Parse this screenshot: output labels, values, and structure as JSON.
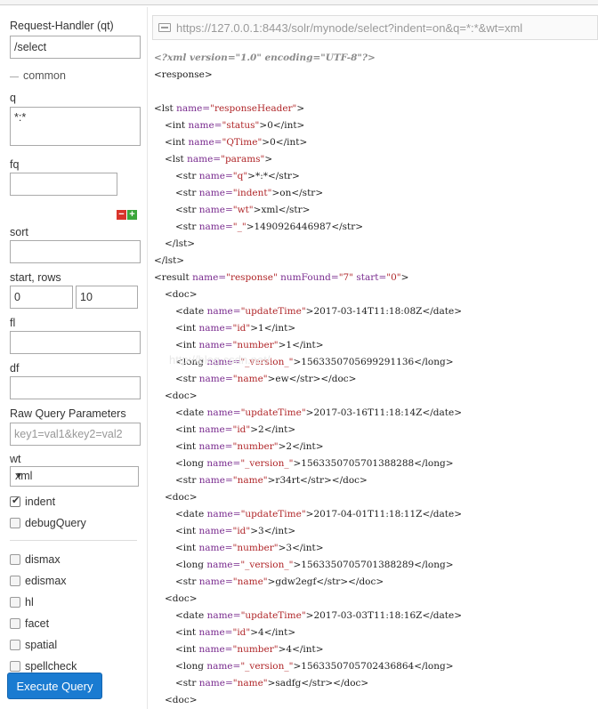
{
  "form": {
    "request_handler": {
      "label": "Request-Handler (qt)",
      "value": "/select"
    },
    "common_legend": "common",
    "q": {
      "label": "q",
      "value": "*:*"
    },
    "fq": {
      "label": "fq",
      "value": ""
    },
    "sort": {
      "label": "sort",
      "value": ""
    },
    "start_rows": {
      "label": "start, rows",
      "start": "0",
      "rows": "10"
    },
    "fl": {
      "label": "fl",
      "value": ""
    },
    "df": {
      "label": "df",
      "value": ""
    },
    "raw": {
      "label": "Raw Query Parameters",
      "placeholder": "key1=val1&key2=val2"
    },
    "wt": {
      "label": "wt",
      "selected": "xml"
    },
    "indent": {
      "label": "indent",
      "checked": true
    },
    "debugQuery": {
      "label": "debugQuery",
      "checked": false
    },
    "options": [
      {
        "label": "dismax",
        "checked": false
      },
      {
        "label": "edismax",
        "checked": false
      },
      {
        "label": "hl",
        "checked": false
      },
      {
        "label": "facet",
        "checked": false
      },
      {
        "label": "spatial",
        "checked": false
      },
      {
        "label": "spellcheck",
        "checked": false
      }
    ],
    "execute_label": "Execute Query"
  },
  "url": "https://127.0.0.1:8443/solr/mynode/select?indent=on&q=*:*&wt=xml",
  "watermark": "http://blog.csdn.net/...",
  "xml_lines": [
    [
      [
        "pi",
        "<?xml version=\"1.0\" encoding=\"UTF-8\"?>"
      ]
    ],
    [
      [
        "t",
        "<response>"
      ]
    ],
    [],
    [
      [
        "t",
        "<lst "
      ],
      [
        "a",
        "name="
      ],
      [
        "v",
        "\"responseHeader\""
      ],
      [
        "t",
        ">"
      ]
    ],
    [
      [
        "t",
        "  <int "
      ],
      [
        "a",
        "name="
      ],
      [
        "v",
        "\"status\""
      ],
      [
        "t",
        ">0</int>"
      ]
    ],
    [
      [
        "t",
        "  <int "
      ],
      [
        "a",
        "name="
      ],
      [
        "v",
        "\"QTime\""
      ],
      [
        "t",
        ">0</int>"
      ]
    ],
    [
      [
        "t",
        "  <lst "
      ],
      [
        "a",
        "name="
      ],
      [
        "v",
        "\"params\""
      ],
      [
        "t",
        ">"
      ]
    ],
    [
      [
        "t",
        "    <str "
      ],
      [
        "a",
        "name="
      ],
      [
        "v",
        "\"q\""
      ],
      [
        "t",
        ">*:*</str>"
      ]
    ],
    [
      [
        "t",
        "    <str "
      ],
      [
        "a",
        "name="
      ],
      [
        "v",
        "\"indent\""
      ],
      [
        "t",
        ">on</str>"
      ]
    ],
    [
      [
        "t",
        "    <str "
      ],
      [
        "a",
        "name="
      ],
      [
        "v",
        "\"wt\""
      ],
      [
        "t",
        ">xml</str>"
      ]
    ],
    [
      [
        "t",
        "    <str "
      ],
      [
        "a",
        "name="
      ],
      [
        "v",
        "\"_\""
      ],
      [
        "t",
        ">1490926446987</str>"
      ]
    ],
    [
      [
        "t",
        "  </lst>"
      ]
    ],
    [
      [
        "t",
        "</lst>"
      ]
    ],
    [
      [
        "t",
        "<result "
      ],
      [
        "a",
        "name="
      ],
      [
        "v",
        "\"response\" "
      ],
      [
        "a",
        "numFound="
      ],
      [
        "v",
        "\"7\" "
      ],
      [
        "a",
        "start="
      ],
      [
        "v",
        "\"0\""
      ],
      [
        "t",
        ">"
      ]
    ],
    [
      [
        "t",
        "  <doc>"
      ]
    ],
    [
      [
        "t",
        "    <date "
      ],
      [
        "a",
        "name="
      ],
      [
        "v",
        "\"updateTime\""
      ],
      [
        "t",
        ">2017-03-14T11:18:08Z</date>"
      ]
    ],
    [
      [
        "t",
        "    <int "
      ],
      [
        "a",
        "name="
      ],
      [
        "v",
        "\"id\""
      ],
      [
        "t",
        ">1</int>"
      ]
    ],
    [
      [
        "t",
        "    <int "
      ],
      [
        "a",
        "name="
      ],
      [
        "v",
        "\"number\""
      ],
      [
        "t",
        ">1</int>"
      ]
    ],
    [
      [
        "t",
        "    <long "
      ],
      [
        "a",
        "name="
      ],
      [
        "v",
        "\"_version_\""
      ],
      [
        "t",
        ">1563350705699291136</long>"
      ]
    ],
    [
      [
        "t",
        "    <str "
      ],
      [
        "a",
        "name="
      ],
      [
        "v",
        "\"name\""
      ],
      [
        "t",
        ">ew</str></doc>"
      ]
    ],
    [
      [
        "t",
        "  <doc>"
      ]
    ],
    [
      [
        "t",
        "    <date "
      ],
      [
        "a",
        "name="
      ],
      [
        "v",
        "\"updateTime\""
      ],
      [
        "t",
        ">2017-03-16T11:18:14Z</date>"
      ]
    ],
    [
      [
        "t",
        "    <int "
      ],
      [
        "a",
        "name="
      ],
      [
        "v",
        "\"id\""
      ],
      [
        "t",
        ">2</int>"
      ]
    ],
    [
      [
        "t",
        "    <int "
      ],
      [
        "a",
        "name="
      ],
      [
        "v",
        "\"number\""
      ],
      [
        "t",
        ">2</int>"
      ]
    ],
    [
      [
        "t",
        "    <long "
      ],
      [
        "a",
        "name="
      ],
      [
        "v",
        "\"_version_\""
      ],
      [
        "t",
        ">1563350705701388288</long>"
      ]
    ],
    [
      [
        "t",
        "    <str "
      ],
      [
        "a",
        "name="
      ],
      [
        "v",
        "\"name\""
      ],
      [
        "t",
        ">r34rt</str></doc>"
      ]
    ],
    [
      [
        "t",
        "  <doc>"
      ]
    ],
    [
      [
        "t",
        "    <date "
      ],
      [
        "a",
        "name="
      ],
      [
        "v",
        "\"updateTime\""
      ],
      [
        "t",
        ">2017-04-01T11:18:11Z</date>"
      ]
    ],
    [
      [
        "t",
        "    <int "
      ],
      [
        "a",
        "name="
      ],
      [
        "v",
        "\"id\""
      ],
      [
        "t",
        ">3</int>"
      ]
    ],
    [
      [
        "t",
        "    <int "
      ],
      [
        "a",
        "name="
      ],
      [
        "v",
        "\"number\""
      ],
      [
        "t",
        ">3</int>"
      ]
    ],
    [
      [
        "t",
        "    <long "
      ],
      [
        "a",
        "name="
      ],
      [
        "v",
        "\"_version_\""
      ],
      [
        "t",
        ">1563350705701388289</long>"
      ]
    ],
    [
      [
        "t",
        "    <str "
      ],
      [
        "a",
        "name="
      ],
      [
        "v",
        "\"name\""
      ],
      [
        "t",
        ">gdw2egf</str></doc>"
      ]
    ],
    [
      [
        "t",
        "  <doc>"
      ]
    ],
    [
      [
        "t",
        "    <date "
      ],
      [
        "a",
        "name="
      ],
      [
        "v",
        "\"updateTime\""
      ],
      [
        "t",
        ">2017-03-03T11:18:16Z</date>"
      ]
    ],
    [
      [
        "t",
        "    <int "
      ],
      [
        "a",
        "name="
      ],
      [
        "v",
        "\"id\""
      ],
      [
        "t",
        ">4</int>"
      ]
    ],
    [
      [
        "t",
        "    <int "
      ],
      [
        "a",
        "name="
      ],
      [
        "v",
        "\"number\""
      ],
      [
        "t",
        ">4</int>"
      ]
    ],
    [
      [
        "t",
        "    <long "
      ],
      [
        "a",
        "name="
      ],
      [
        "v",
        "\"_version_\""
      ],
      [
        "t",
        ">1563350705702436864</long>"
      ]
    ],
    [
      [
        "t",
        "    <str "
      ],
      [
        "a",
        "name="
      ],
      [
        "v",
        "\"name\""
      ],
      [
        "t",
        ">sadfg</str></doc>"
      ]
    ],
    [
      [
        "t",
        "  <doc>"
      ]
    ]
  ]
}
